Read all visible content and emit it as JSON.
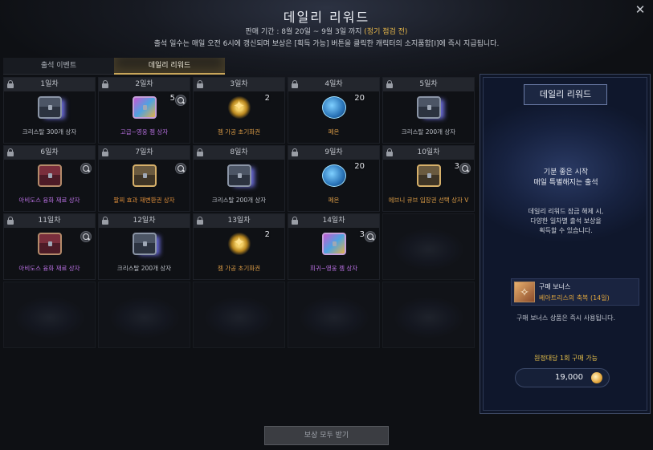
{
  "window": {
    "title": "데일리 리워드",
    "sale_period_prefix": "판매 기간 : 8월 20일 ~ 9월 3일 까지 ",
    "sale_period_highlight": "(정기 점검 전)",
    "description": "출석 일수는 매일 오전 6시에 갱신되며 보상은 [획득 가능] 버튼을 클릭한 캐릭터의 소지품함[I]에 즉시 지급됩니다."
  },
  "tabs": [
    {
      "label": "출석 이벤트",
      "active": false
    },
    {
      "label": "데일리 리워드",
      "active": true
    }
  ],
  "days": [
    {
      "label": "1일차",
      "icon": "chest-icon",
      "icon_style": "glow",
      "count": "",
      "item": "크리스탈 300개 상자",
      "color": "default",
      "inspect": false
    },
    {
      "label": "2일차",
      "icon": "chest-icon",
      "icon_style": "colorful",
      "count": "5",
      "item": "고급~영웅 젬 상자",
      "color": "purple",
      "inspect": true
    },
    {
      "label": "3일차",
      "icon": "gold-star-icon",
      "icon_style": "",
      "count": "2",
      "item": "젬 가공 초기화권",
      "color": "gold",
      "inspect": false
    },
    {
      "label": "4일차",
      "icon": "gem-icon",
      "icon_style": "",
      "count": "20",
      "item": "페온",
      "color": "gold",
      "inspect": false
    },
    {
      "label": "5일차",
      "icon": "chest-icon",
      "icon_style": "glow",
      "count": "",
      "item": "크리스탈 200개 상자",
      "color": "default",
      "inspect": false
    },
    {
      "label": "6일차",
      "icon": "chest-icon",
      "icon_style": "red",
      "count": "",
      "item": "아비도스 융화 재료 상자",
      "color": "purple",
      "inspect": true
    },
    {
      "label": "7일차",
      "icon": "chest-icon",
      "icon_style": "gold",
      "count": "",
      "item": "팔찌 효과 재변환권 상자",
      "color": "orange",
      "inspect": true
    },
    {
      "label": "8일차",
      "icon": "chest-icon",
      "icon_style": "glow",
      "count": "",
      "item": "크리스탈 200개 상자",
      "color": "default",
      "inspect": false
    },
    {
      "label": "9일차",
      "icon": "gem-icon",
      "icon_style": "",
      "count": "20",
      "item": "페온",
      "color": "gold",
      "inspect": false
    },
    {
      "label": "10일차",
      "icon": "chest-icon",
      "icon_style": "gold",
      "count": "3",
      "item": "에브니 큐브 입장권 선택 상자 V",
      "color": "gold",
      "inspect": true
    },
    {
      "label": "11일차",
      "icon": "chest-icon",
      "icon_style": "red",
      "count": "",
      "item": "아비도스 융화 재료 상자",
      "color": "purple",
      "inspect": true
    },
    {
      "label": "12일차",
      "icon": "chest-icon",
      "icon_style": "glow",
      "count": "",
      "item": "크리스탈 200개 상자",
      "color": "default",
      "inspect": false
    },
    {
      "label": "13일차",
      "icon": "gold-star-icon",
      "icon_style": "",
      "count": "2",
      "item": "젬 가공 초기화권",
      "color": "gold",
      "inspect": false
    },
    {
      "label": "14일차",
      "icon": "chest-icon",
      "icon_style": "colorful",
      "count": "3",
      "item": "희귀~영웅 젬 상자",
      "color": "purple",
      "inspect": true
    }
  ],
  "panel": {
    "title": "데일리 리워드",
    "tagline_1": "기분 좋은 시작",
    "tagline_2": "매일 특별해지는 출석",
    "desc_1": "데일리 리워드 잠금 해제 시,",
    "desc_2": "다양한 일차별 출석 보상을",
    "desc_3": "획득할 수 있습니다.",
    "bonus_title": "구매 보너스",
    "bonus_item": "베아트리스의 축복 (14일)",
    "bonus_note": "구매 보너스 상품은 즉시 사용됩니다.",
    "limit": "원정대당 1회 구매 가능",
    "price": "19,000"
  },
  "claim_button": "보상 모두 받기"
}
